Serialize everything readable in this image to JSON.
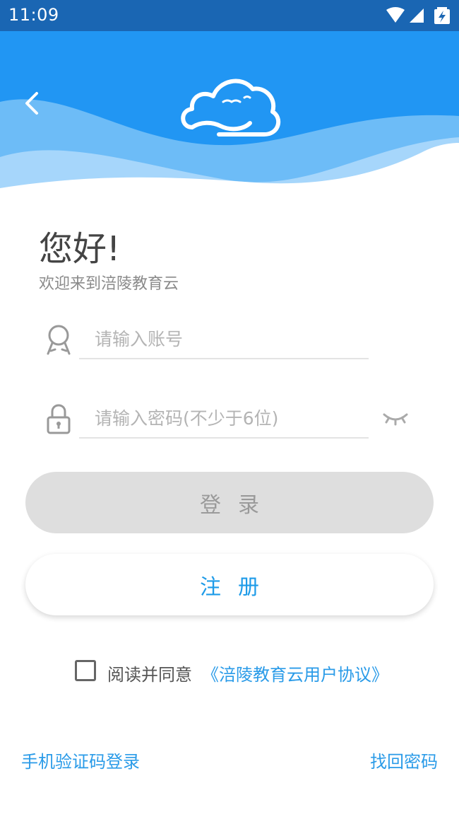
{
  "status_bar": {
    "time": "11:09",
    "icons": [
      "wifi-icon",
      "cell-signal-icon",
      "battery-charging-icon"
    ]
  },
  "header": {
    "back_icon": "chevron-left-icon",
    "logo": "cloud-logo",
    "colors": {
      "primary": "#2196f3",
      "wave_mid": "#6dbcf7",
      "wave_light": "#a6d6fb"
    }
  },
  "greeting": {
    "title": "您好!",
    "subtitle": "欢迎来到涪陵教育云"
  },
  "form": {
    "account_placeholder": "请输入账号",
    "password_placeholder": "请输入密码(不少于6位)",
    "account_icon": "user-icon",
    "password_icon": "lock-icon",
    "eye_icon": "eye-closed-icon"
  },
  "buttons": {
    "login": "登录",
    "register": "注册"
  },
  "agreement": {
    "text": "阅读并同意",
    "link": "《涪陵教育云用户协议》",
    "checked": false
  },
  "footer": {
    "sms_login": "手机验证码登录",
    "forgot_password": "找回密码"
  }
}
